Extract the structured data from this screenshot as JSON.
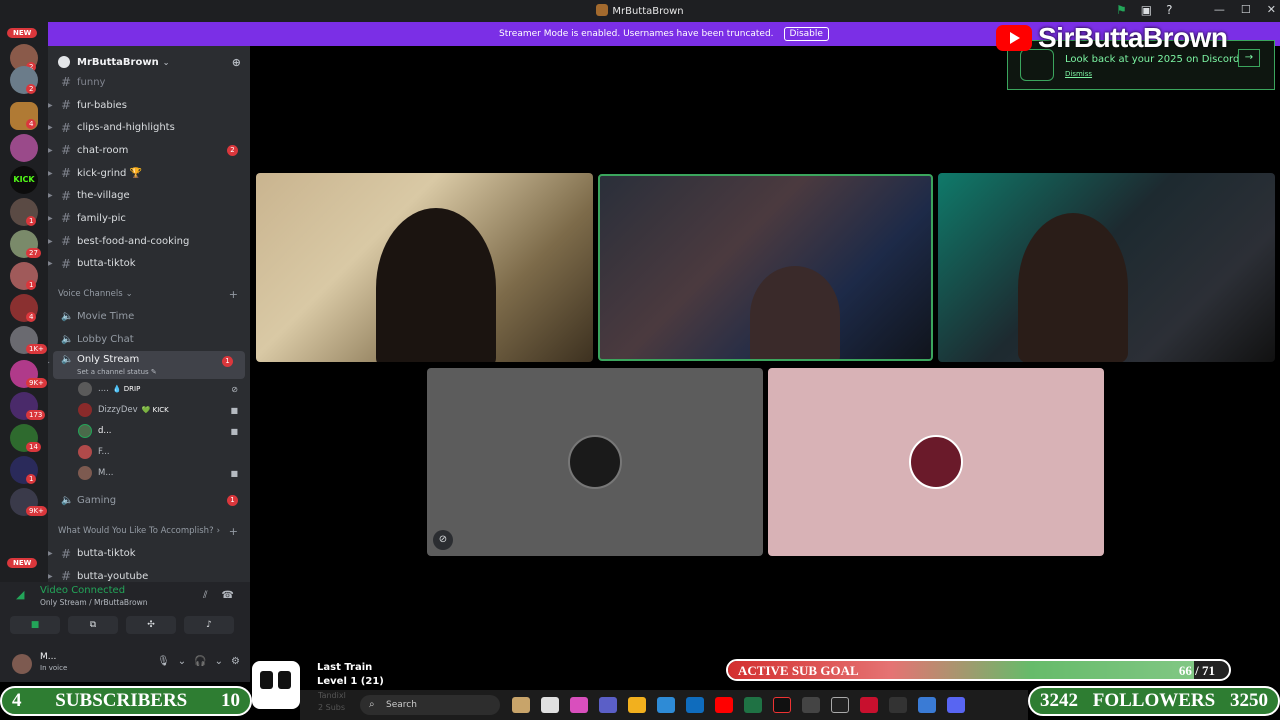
{
  "window": {
    "title": "MrButtaBrown"
  },
  "banner": {
    "text": "Streamer Mode is enabled. Usernames have been truncated.",
    "button": "Disable"
  },
  "rail": {
    "new_top": "NEW",
    "new_bottom": "NEW",
    "badges": [
      "2",
      "2",
      "4",
      "1",
      "27",
      "1",
      "4",
      "1K+",
      "9K+",
      "173",
      "14",
      "1",
      "9K+"
    ],
    "kick_label": "KICK"
  },
  "server": {
    "name": "MrButtaBrown"
  },
  "text_channels": [
    {
      "name": "funny"
    },
    {
      "name": "fur-babies"
    },
    {
      "name": "clips-and-highlights"
    },
    {
      "name": "chat-room",
      "count": "2"
    },
    {
      "name": "kick-grind 🏆"
    },
    {
      "name": "the-village"
    },
    {
      "name": "family-pic"
    },
    {
      "name": "best-food-and-cooking"
    },
    {
      "name": "butta-tiktok"
    }
  ],
  "voice_category": "Voice Channels",
  "voice_channels": {
    "movie": "Movie Time",
    "lobby": "Lobby Chat",
    "only_stream": "Only Stream",
    "only_stream_count": "1",
    "only_stream_status": "Set a channel status",
    "gaming": "Gaming",
    "gaming_count": "1"
  },
  "voice_users": [
    {
      "name": "....",
      "tag": "💧 DRIP"
    },
    {
      "name": "DizzyDev",
      "tag": "💚 KICK"
    },
    {
      "name": "d..."
    },
    {
      "name": "F..."
    },
    {
      "name": "M..."
    }
  ],
  "category2": "What Would You Like To Accomplish?",
  "category2_channels": [
    "butta-tiktok",
    "butta-youtube"
  ],
  "voice_panel": {
    "title": "Video Connected",
    "subtitle": "Only Stream / MrButtaBrown"
  },
  "user": {
    "name": "M...",
    "status": "In voice"
  },
  "overlay": {
    "yt_name": "SirButtaBrown",
    "recap_text": "Look back at your 2025 on Discord",
    "recap_dismiss": "Dismiss",
    "subs_value": "4",
    "subs_label": "SUBSCRIBERS",
    "subs_goal": "10",
    "followers_value": "3242",
    "followers_label": "FOLLOWERS",
    "followers_goal": "3250",
    "goal_label": "ACTIVE SUB GOAL",
    "goal_count": "66 / 71",
    "goal_fraction": 0.93,
    "train_title": "Last Train",
    "train_level": "Level 1 (21)",
    "train_sub1": "Tandixl",
    "train_sub2": "2 Subs"
  },
  "taskbar": {
    "search_placeholder": "Search"
  },
  "colors": {
    "accent": "#7b2fe6",
    "green": "#3ba55d",
    "danger": "#da373c",
    "sidebar": "#2b2d31"
  }
}
